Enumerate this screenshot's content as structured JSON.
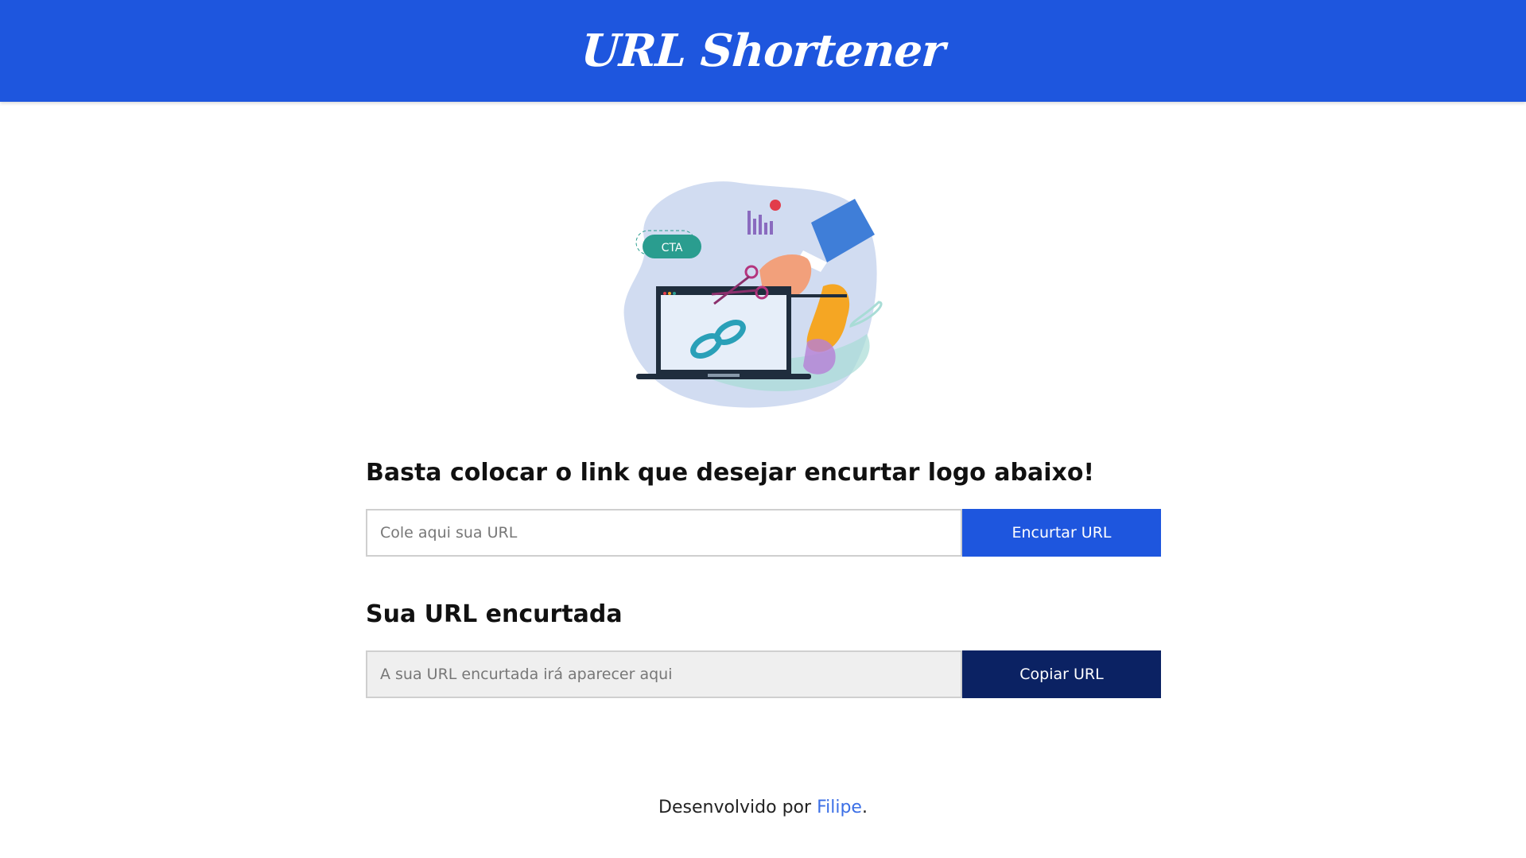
{
  "header": {
    "logo_text": "URL Shortener",
    "background": "#1e56de"
  },
  "illustration": {
    "badge_text": "CTA",
    "icon": "cut-link-illustration"
  },
  "shorten_section": {
    "title": "Basta colocar o link que desejar encurtar logo abaixo!",
    "input_placeholder": "Cole aqui sua URL",
    "input_value": "",
    "button_label": "Encurtar URL"
  },
  "result_section": {
    "title": "Sua URL encurtada",
    "output_placeholder": "A sua URL encurtada irá aparecer aqui",
    "output_value": "",
    "button_label": "Copiar URL"
  },
  "footer": {
    "prefix": "Desenvolvido por ",
    "author_link": "Filipe",
    "suffix": "."
  },
  "colors": {
    "primary": "#1e56de",
    "dark_button": "#0b2263",
    "link": "#3b6fe6"
  }
}
